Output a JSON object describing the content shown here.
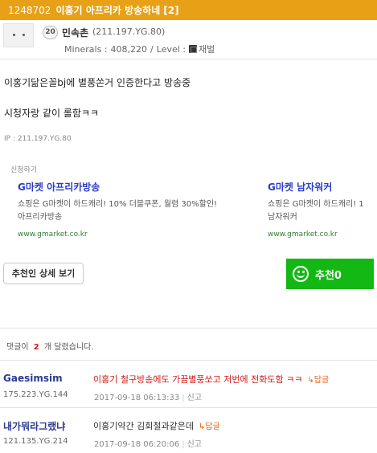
{
  "post": {
    "id": "1248702",
    "title": "이흥기 아프리카 방송하네",
    "comment_count_label": "[2]",
    "author": {
      "level": "20",
      "nickname": "민속촌",
      "ip": "(211.197.YG.80)",
      "minerals_label": "Minerals :",
      "minerals_value": "408,220",
      "level_label": "Level :",
      "level_name": "재벌"
    },
    "body_lines": [
      "이홍기닮은꼴bj에 별풍쏜거 인증한다고 방송중",
      "시청자랑 같이 롤함ㅋㅋ"
    ],
    "ip_label": "IP : 211.197.YG.80"
  },
  "ads": {
    "label": "신청하기",
    "items": [
      {
        "title": "G마켓 아프리카방송",
        "desc1": "쇼핑은 G마켓이 하드캐리! 10% 더블쿠폰, 월렴 30%할인!",
        "desc2": "아프리카방송",
        "url": "www.gmarket.co.kr"
      },
      {
        "title": "G마켓 남자워커",
        "desc1": "쇼핑은 G마켓이 하드캐리! 1",
        "desc2": "남자워커",
        "url": "www.gmarket.co.kr"
      }
    ]
  },
  "buttons": {
    "recommenders_detail": "추천인 상세 보기",
    "recommend": "추천0"
  },
  "comments_header": {
    "prefix": "댓글이",
    "count": "2",
    "suffix": "개 달렸습니다."
  },
  "comments": [
    {
      "nick": "Gaesimsim",
      "ip": "175.223.YG.144",
      "text": "이홍기 철구방송에도 가끔별풍쏘고 저번에 전화도함 ㅋㅋ",
      "reply": "↳답글",
      "time": "2017-09-18 06:13:33",
      "report": "신고",
      "text_color": "#d21a1a"
    },
    {
      "nick": "내가뭐라그랬냐",
      "ip": "121.135.YG.214",
      "text": "이홍기약간 김회철과같은데",
      "reply": "↳답글",
      "time": "2017-09-18 06:20:06",
      "report": "신고",
      "text_color": "#333333"
    }
  ],
  "colors": {
    "title_bar": "#e8a016",
    "recommend_button": "#14b814",
    "ad_title": "#2a3cc8",
    "ad_url": "#2e7d32"
  }
}
